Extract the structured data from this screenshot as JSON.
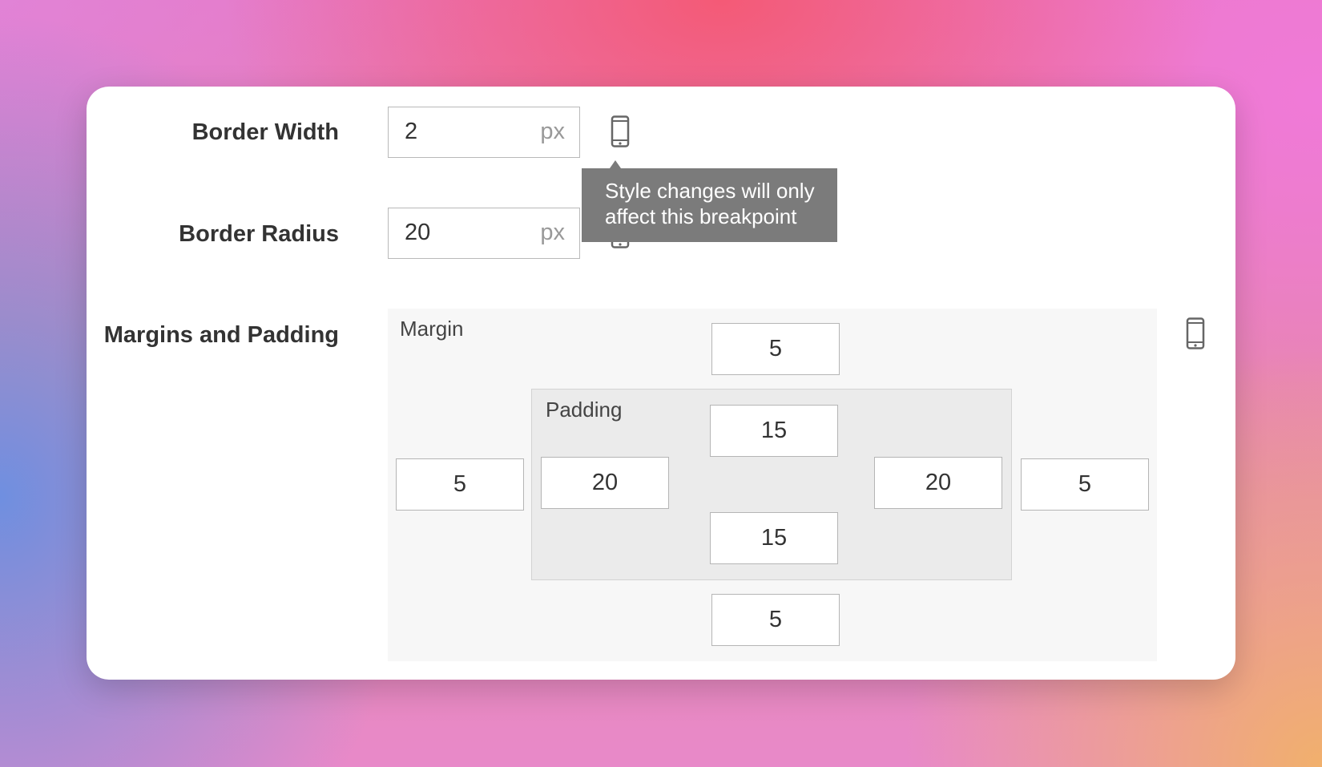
{
  "rows": {
    "border_width": {
      "label": "Border Width",
      "value": "2",
      "unit": "px"
    },
    "border_radius": {
      "label": "Border Radius",
      "value": "20",
      "unit": "px"
    },
    "margins_padding": {
      "label": "Margins and Padding"
    }
  },
  "tooltip": {
    "text_line1": "Style changes will only",
    "text_line2": "affect this breakpoint"
  },
  "spacing": {
    "margin_label": "Margin",
    "padding_label": "Padding",
    "margin": {
      "top": "5",
      "right": "5",
      "bottom": "5",
      "left": "5"
    },
    "padding": {
      "top": "15",
      "right": "20",
      "bottom": "15",
      "left": "20"
    }
  },
  "icons": {
    "breakpoint": "mobile-phone-icon"
  },
  "colors": {
    "tooltip_bg": "#7b7b7b",
    "card_bg": "#ffffff",
    "icon": "#666666"
  }
}
